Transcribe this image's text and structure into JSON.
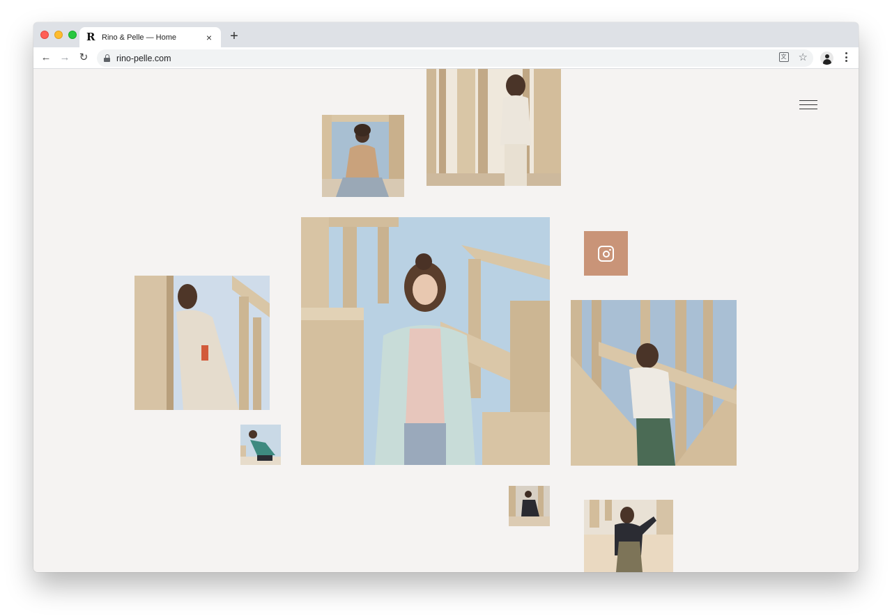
{
  "browser": {
    "tab": {
      "favicon": "R",
      "title": "Rino & Pelle — Home",
      "close_icon": "×"
    },
    "new_tab_icon": "+",
    "nav": {
      "back": "←",
      "forward": "→",
      "reload": "↻"
    },
    "address": {
      "url": "rino-pelle.com"
    }
  },
  "page": {
    "menu_icon": "hamburger-menu-icon",
    "social": {
      "icon": "instagram-icon",
      "color": "#c99478"
    },
    "gallery": [
      {
        "name": "photo-gold-jacket-seated",
        "sky": "#9fb7cc",
        "garment": "#c9a27c",
        "ground": "#d8cbb8"
      },
      {
        "name": "photo-white-outfit-standing",
        "sky": "#efe8dc",
        "garment": "#ece6dc",
        "ground": "#cdb99d"
      },
      {
        "name": "photo-mint-coat-hero",
        "sky": "#b9d1e3",
        "garment": "#c8dcd8",
        "ground": "#d9c7a9"
      },
      {
        "name": "photo-trench-coat-leaning",
        "sky": "#cfdcea",
        "garment": "#e5dccd",
        "ground": "#d7c3a5"
      },
      {
        "name": "photo-teal-jacket-small",
        "sky": "#c9d9e6",
        "garment": "#3e8a80",
        "ground": "#e7dccb"
      },
      {
        "name": "photo-white-jacket-beams",
        "sky": "#a9bfd4",
        "garment": "#eeeae3",
        "ground": "#d6c3a6"
      },
      {
        "name": "photo-dark-outfit-tiny",
        "sky": "#d8d0c4",
        "garment": "#2a2a30",
        "ground": "#dccbb3"
      },
      {
        "name": "photo-dark-jacket-sand",
        "sky": "#e9e1d5",
        "garment": "#2b2c33",
        "ground": "#ead9c1"
      }
    ]
  },
  "colors": {
    "background": "#f5f3f2",
    "stone": "#d8c4a4",
    "stone_shadow": "#b89f7c"
  }
}
